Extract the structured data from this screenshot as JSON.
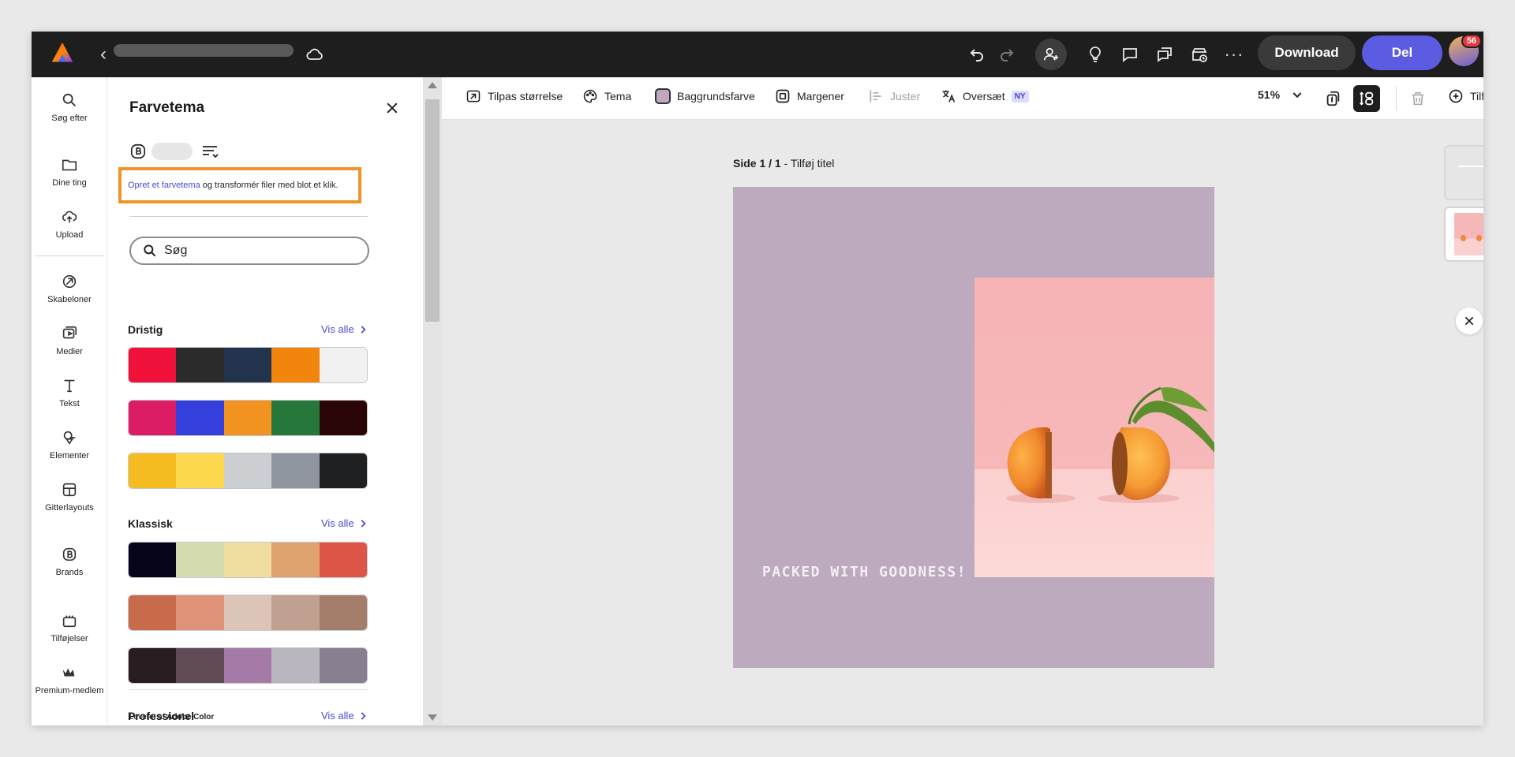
{
  "topbar": {
    "download_label": "Download",
    "share_label": "Del",
    "more_label": "···",
    "notification_count": "56"
  },
  "rail": {
    "items": [
      {
        "label": "Søg efter",
        "icon": "search-icon"
      },
      {
        "label": "Dine ting",
        "icon": "folder-icon"
      },
      {
        "label": "Upload",
        "icon": "upload-cloud-icon"
      },
      {
        "label": "Skabeloner",
        "icon": "templates-icon"
      },
      {
        "label": "Medier",
        "icon": "media-icon"
      },
      {
        "label": "Tekst",
        "icon": "text-icon"
      },
      {
        "label": "Elementer",
        "icon": "elements-icon"
      },
      {
        "label": "Gitterlayouts",
        "icon": "grid-layout-icon"
      },
      {
        "label": "Brands",
        "icon": "brand-icon"
      },
      {
        "label": "Tilføjelser",
        "icon": "addons-icon"
      },
      {
        "label": "Premium-medlem",
        "icon": "premium-crown-icon"
      }
    ]
  },
  "panel": {
    "title": "Farvetema",
    "promo_link": "Opret et farvetema",
    "promo_text": "og transformér filer med blot et klik.",
    "search_placeholder": "Søg",
    "sections": [
      {
        "title": "Dristig",
        "link": "Vis alle",
        "palettes": [
          [
            "#f0113a",
            "#2b2b2b",
            "#22344d",
            "#f2860d",
            "#f1f1f1"
          ],
          [
            "#dc1c64",
            "#3540dc",
            "#f29220",
            "#26783a",
            "#2a0506"
          ],
          [
            "#f5bc22",
            "#fbd84e",
            "#ccd0d2",
            "#8e959e",
            "#1e2021"
          ]
        ]
      },
      {
        "title": "Klassisk",
        "link": "Vis alle",
        "palettes": [
          [
            "#050619",
            "#d5dbb0",
            "#f0de9e",
            "#e0a26e",
            "#dc5546"
          ],
          [
            "#c76b4a",
            "#e09278",
            "#dcc4b8",
            "#c0a090",
            "#a37e6a"
          ],
          [
            "#2a1d21",
            "#5f4a55",
            "#a57aa7",
            "#b9b6bf",
            "#888090"
          ]
        ]
      },
      {
        "title": "Professionel",
        "link": "Vis alle",
        "palettes": []
      }
    ],
    "source_prefix": "Leveret af",
    "source_name": "Adobe Color"
  },
  "toolbar": {
    "resize": "Tilpas størrelse",
    "theme": "Tema",
    "background_color": "Baggrundsfarve",
    "margins": "Margener",
    "align": "Juster",
    "translate": "Oversæt",
    "translate_badge": "NY",
    "zoom": "51%",
    "add": "Tilføj"
  },
  "canvas": {
    "page_prefix": "Side 1 / 1",
    "page_title": "Tilføj titel",
    "artboard_text": "PACKED WITH GOODNESS!",
    "background_color": "#beaabf"
  },
  "colors": {
    "accent": "#5b5ce2",
    "link": "#4a4ad6",
    "highlight_border": "#f0932b"
  }
}
